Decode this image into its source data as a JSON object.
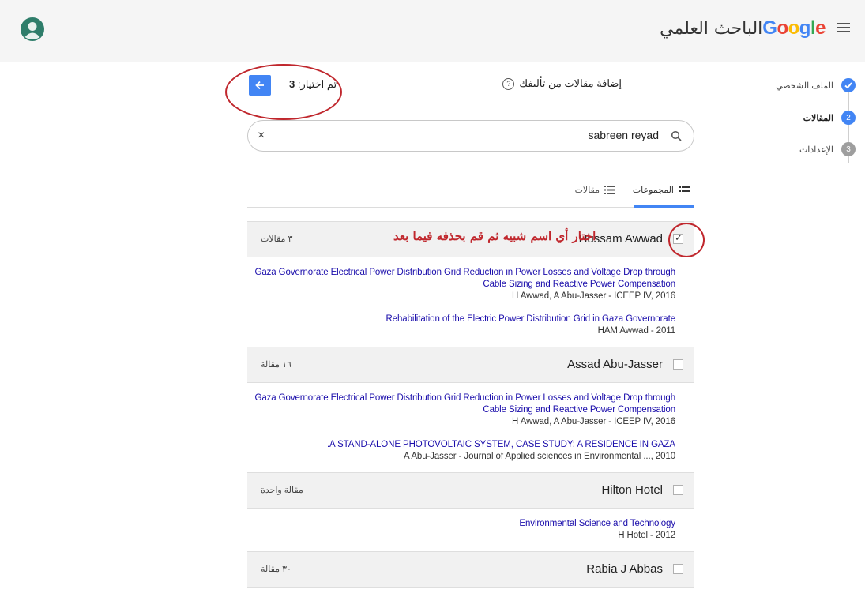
{
  "header": {
    "logo_google": "Google",
    "logo_title": "الباحث العلمي",
    "colors": {
      "background": "#f5f5f5",
      "avatar": "#2e7d6a"
    }
  },
  "stepper": [
    {
      "number": "",
      "label": "الملف الشخصي",
      "state": "done",
      "color": "#4285f4"
    },
    {
      "number": "2",
      "label": "المقالات",
      "state": "active",
      "color": "#4285f4"
    },
    {
      "number": "3",
      "label": "الإعدادات",
      "state": "todo",
      "color": "#9e9e9e"
    }
  ],
  "dialog": {
    "title": "إضافة مقالات من تأليفك",
    "help_glyph": "?",
    "selected_label": "تم اختيار:",
    "selected_count": "3"
  },
  "search": {
    "value": "sabreen reyad",
    "clear_glyph": "×"
  },
  "tabs": {
    "groups": "المجموعات",
    "articles": "مقالات",
    "accent": "#4285f4"
  },
  "annotation": {
    "note": "اختار أي اسم شبيه ثم قم بحذفه فيما بعد",
    "color": "#c0272d"
  },
  "groups": [
    {
      "name": "Hussam Awwad",
      "count": "٣ مقالات",
      "checked": true,
      "articles": [
        {
          "title": "Gaza Governorate Electrical Power Distribution Grid Reduction in Power Losses and Voltage Drop through Cable Sizing and Reactive Power Compensation",
          "meta": "H Awwad, A Abu-Jasser - ICEEP IV, 2016"
        },
        {
          "title": "Rehabilitation of the Electric Power Distribution Grid in Gaza Governorate",
          "meta": "HAM Awwad - 2011"
        }
      ]
    },
    {
      "name": "Assad Abu-Jasser",
      "count": "١٦ مقالة",
      "checked": false,
      "articles": [
        {
          "title": "Gaza Governorate Electrical Power Distribution Grid Reduction in Power Losses and Voltage Drop through Cable Sizing and Reactive Power Compensation",
          "meta": "H Awwad, A Abu-Jasser - ICEEP IV, 2016"
        },
        {
          "title": ".A STAND-ALONE PHOTOVOLTAIC SYSTEM, CASE STUDY: A RESIDENCE IN GAZA",
          "meta": "A Abu-Jasser - Journal of Applied sciences in Environmental ..., 2010"
        }
      ]
    },
    {
      "name": "Hilton Hotel",
      "count": "مقالة واحدة",
      "checked": false,
      "articles": [
        {
          "title": "Environmental Science and Technology",
          "meta": "H Hotel - 2012"
        }
      ]
    },
    {
      "name": "Rabia J Abbas",
      "count": "٣٠ مقالة",
      "checked": false,
      "articles": []
    }
  ]
}
